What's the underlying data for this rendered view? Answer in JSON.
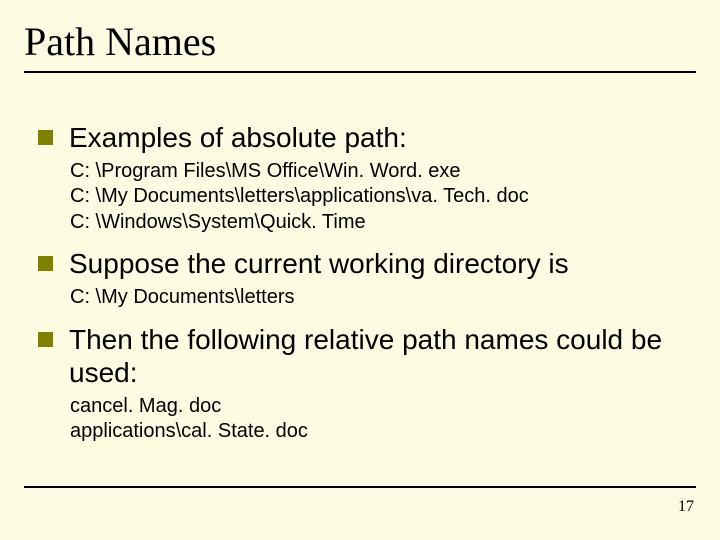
{
  "title": "Path Names",
  "bullets": [
    {
      "text": "Examples of absolute path:",
      "sublines": [
        "C: \\Program Files\\MS Office\\Win. Word. exe",
        "C: \\My Documents\\letters\\applications\\va. Tech. doc",
        "C: \\Windows\\System\\Quick. Time"
      ]
    },
    {
      "text": "Suppose the current working directory is",
      "sublines": [
        "C: \\My Documents\\letters"
      ]
    },
    {
      "text": "Then the following relative path names could be used:",
      "sublines": [
        "cancel. Mag. doc",
        "applications\\cal. State. doc"
      ]
    }
  ],
  "page_number": "17"
}
